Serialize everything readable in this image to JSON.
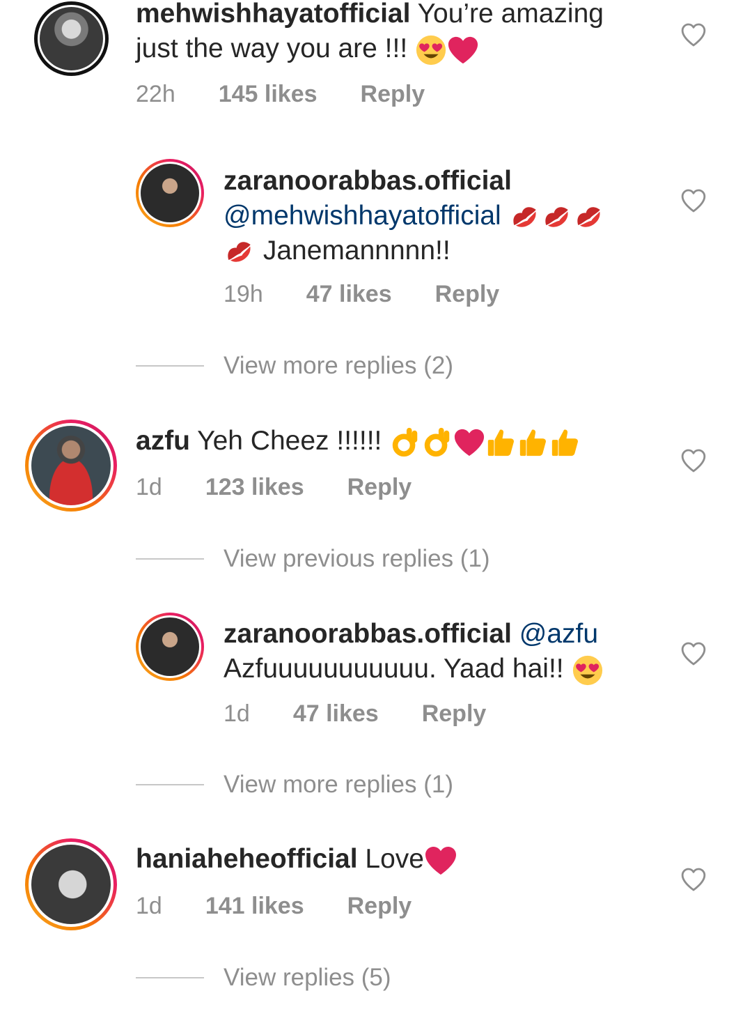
{
  "comments": [
    {
      "username": "mehwishhayatofficial",
      "text_line1": "You’re amazing",
      "text_line2": "just the way you are !!!",
      "time": "22h",
      "likes": "145 likes",
      "reply": "Reply",
      "emojis": [
        "heart-eyes-emoji",
        "red-heart-emoji"
      ]
    },
    {
      "username": "zaranoorabbas.official",
      "mention": "@mehwishhayatofficial",
      "text": "Janemannnnn!!",
      "time": "19h",
      "likes": "47 likes",
      "reply": "Reply",
      "emojis": [
        "kiss-mark-emoji",
        "kiss-mark-emoji",
        "kiss-mark-emoji",
        "kiss-mark-emoji"
      ]
    },
    {
      "username": "azfu",
      "text": "Yeh Cheez !!!!!!",
      "time": "1d",
      "likes": "123 likes",
      "reply": "Reply",
      "emojis": [
        "ok-hand-emoji",
        "ok-hand-emoji",
        "red-heart-emoji",
        "thumbs-up-emoji",
        "thumbs-up-emoji",
        "thumbs-up-emoji"
      ]
    },
    {
      "username": "zaranoorabbas.official",
      "mention": "@azfu",
      "text": "Azfuuuuuuuuuuu. Yaad hai!!",
      "time": "1d",
      "likes": "47 likes",
      "reply": "Reply",
      "emojis": [
        "heart-eyes-emoji"
      ]
    },
    {
      "username": "haniaheheofficial",
      "text": "Love",
      "time": "1d",
      "likes": "141 likes",
      "reply": "Reply",
      "emojis": [
        "red-heart-emoji"
      ]
    }
  ],
  "threads": [
    {
      "label": "View more replies (2)"
    },
    {
      "label": "View previous replies (1)"
    },
    {
      "label": "View more replies (1)"
    },
    {
      "label": "View replies (5)"
    }
  ],
  "colors": {
    "text": "#262626",
    "meta": "#8e8e8e",
    "mention": "#00376b",
    "heart_emoji": "#e0245e",
    "ring_gradient_start": "#f9a825",
    "ring_gradient_end": "#c2185b"
  },
  "icons": {
    "like": "heart-outline-icon"
  }
}
